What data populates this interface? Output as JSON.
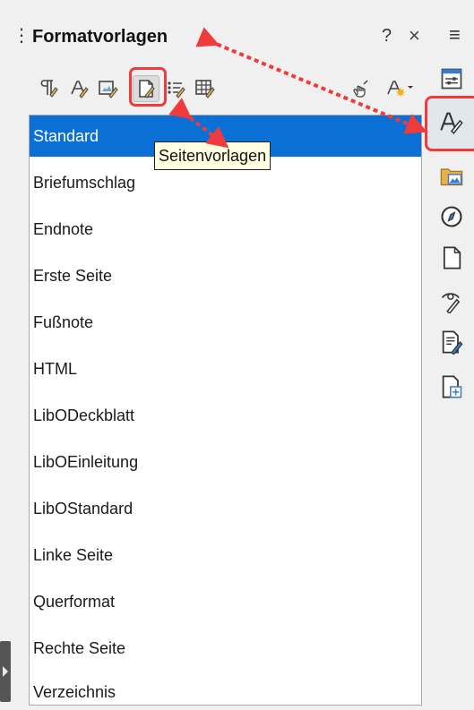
{
  "panel": {
    "grip_glyph": "⋮",
    "title": "Formatvorlagen",
    "help_label": "?",
    "close_label": "×",
    "menu_label": "≡"
  },
  "toolbar": {
    "icons": [
      {
        "name": "paragraph-styles-icon",
        "active": false
      },
      {
        "name": "character-styles-icon",
        "active": false
      },
      {
        "name": "frame-styles-icon",
        "active": false
      },
      {
        "name": "page-styles-icon",
        "active": true
      },
      {
        "name": "list-styles-icon",
        "active": false
      },
      {
        "name": "table-styles-icon",
        "active": false
      },
      {
        "name": "fill-format-mode-icon",
        "active": false
      },
      {
        "name": "new-style-from-selection-icon",
        "active": false
      }
    ]
  },
  "tooltip": {
    "text": "Seitenvorlagen"
  },
  "styles": {
    "items": [
      {
        "label": "Standard",
        "selected": true
      },
      {
        "label": "Briefumschlag",
        "selected": false
      },
      {
        "label": "Endnote",
        "selected": false
      },
      {
        "label": "Erste Seite",
        "selected": false
      },
      {
        "label": "Fußnote",
        "selected": false
      },
      {
        "label": "HTML",
        "selected": false
      },
      {
        "label": "LibODeckblatt",
        "selected": false
      },
      {
        "label": "LibOEinleitung",
        "selected": false
      },
      {
        "label": "LibOStandard",
        "selected": false
      },
      {
        "label": "Linke Seite",
        "selected": false
      },
      {
        "label": "Querformat",
        "selected": false
      },
      {
        "label": "Rechte Seite",
        "selected": false
      },
      {
        "label": "Verzeichnis",
        "selected": false
      }
    ]
  },
  "deck": {
    "icons": [
      {
        "name": "properties-icon",
        "active": false
      },
      {
        "name": "styles-deck-icon",
        "active": true
      },
      {
        "name": "gallery-icon",
        "active": false
      },
      {
        "name": "navigator-icon",
        "active": false
      },
      {
        "name": "page-deck-icon",
        "active": false
      },
      {
        "name": "style-inspector-icon",
        "active": false
      },
      {
        "name": "manage-changes-icon",
        "active": false
      },
      {
        "name": "design-icon",
        "active": false
      }
    ]
  },
  "colors": {
    "selection": "#0a70d6",
    "annotation_red": "#ef3b3b",
    "tooltip_bg": "#ffffe1"
  }
}
